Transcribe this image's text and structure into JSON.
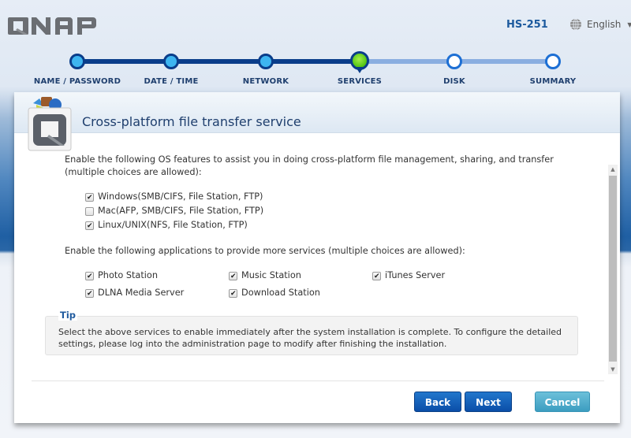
{
  "header": {
    "brand": "QNAP",
    "model": "HS-251",
    "language": "English",
    "language_icon": "globe-icon"
  },
  "wizard": {
    "steps": [
      {
        "label": "NAME / PASSWORD",
        "state": "done"
      },
      {
        "label": "DATE / TIME",
        "state": "done"
      },
      {
        "label": "NETWORK",
        "state": "done"
      },
      {
        "label": "SERVICES",
        "state": "current"
      },
      {
        "label": "DISK",
        "state": "todo"
      },
      {
        "label": "SUMMARY",
        "state": "todo"
      }
    ]
  },
  "panel": {
    "title": "Cross-platform file transfer service",
    "os_intro": "Enable the following OS features to assist you in doing cross-platform file management, sharing, and transfer (multiple choices are allowed):",
    "os_options": [
      {
        "label": "Windows(SMB/CIFS, File Station, FTP)",
        "checked": true
      },
      {
        "label": "Mac(AFP, SMB/CIFS, File Station, FTP)",
        "checked": false
      },
      {
        "label": "Linux/UNIX(NFS, File Station, FTP)",
        "checked": true
      }
    ],
    "apps_intro": "Enable the following applications to provide more services (multiple choices are allowed):",
    "apps": [
      {
        "label": "Photo Station",
        "checked": true
      },
      {
        "label": "Music Station",
        "checked": true
      },
      {
        "label": "iTunes Server",
        "checked": true
      },
      {
        "label": "DLNA Media Server",
        "checked": true
      },
      {
        "label": "Download Station",
        "checked": true
      }
    ],
    "tip": {
      "title": "Tip",
      "text": "Select the above services to enable immediately after the system installation is complete. To configure the detailed settings, please log into the administration page to modify after finishing the installation."
    }
  },
  "buttons": {
    "back": "Back",
    "next": "Next",
    "cancel": "Cancel"
  },
  "colors": {
    "accent": "#0a3d8a",
    "step_done_fill": "#3db5f0",
    "step_current": "#56c616",
    "title": "#1f3f6e"
  }
}
